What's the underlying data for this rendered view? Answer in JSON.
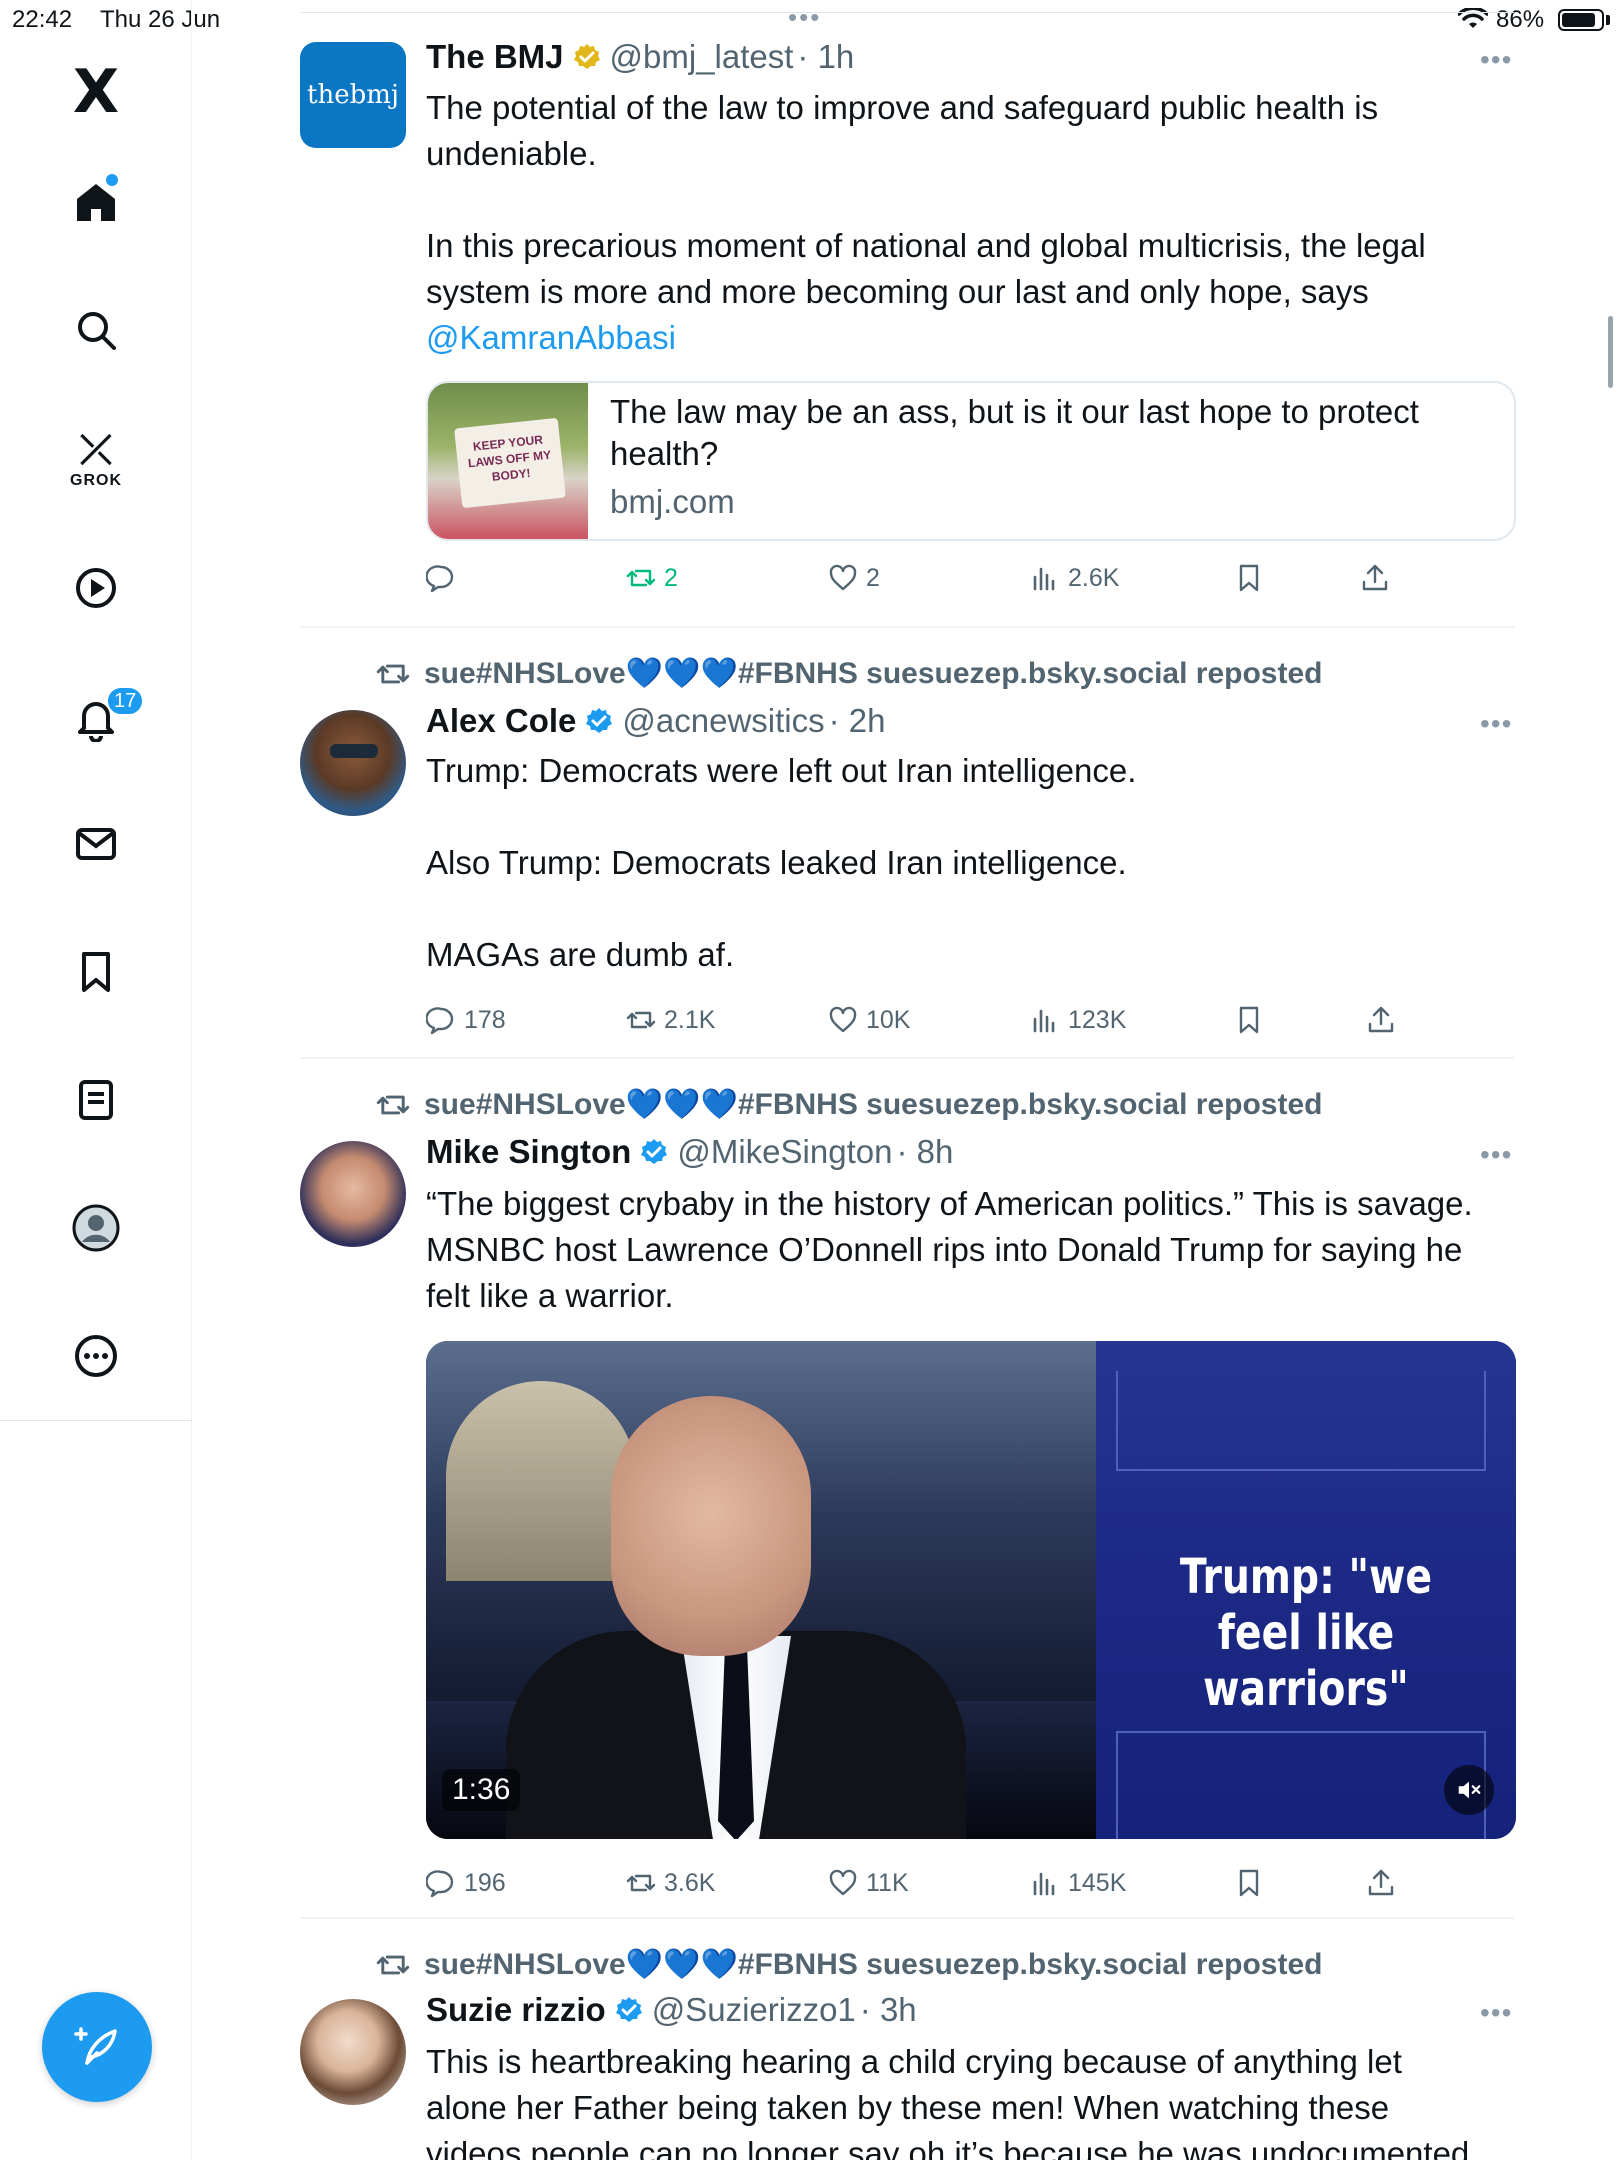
{
  "status": {
    "time": "22:42",
    "date": "Thu 26 Jun",
    "battery": "86%",
    "battery_level": 0.86
  },
  "sidebar": {
    "logo": "X",
    "grok_label": "GROK",
    "notifications_badge": "17",
    "items": [
      "home-icon",
      "search-icon",
      "grok-icon",
      "video-icon",
      "notifications-icon",
      "messages-icon",
      "bookmarks-icon",
      "lists-icon",
      "profile-icon",
      "more-icon"
    ],
    "compose_icon": "compose-icon"
  },
  "posts": [
    {
      "name": "The BMJ",
      "handle": "@bmj_latest",
      "time": "· 1h",
      "verified": "gold",
      "avatar_text": "thebmj",
      "body": [
        "The potential of the law to improve and safeguard public health is undeniable.",
        "",
        "In this precarious moment of national and global multicrisis, the legal system is more and more becoming our last and only hope, says"
      ],
      "mention": "@KamranAbbasi",
      "card": {
        "title": "The law may be an ass, but is it our last hope to protect health?",
        "domain": "bmj.com",
        "sign": "KEEP YOUR LAWS OFF MY BODY!"
      },
      "stats": {
        "replies": "",
        "reposts": "2",
        "likes": "2",
        "views": "2.6K"
      }
    },
    {
      "repost_by": "sue#NHSLove",
      "repost_hearts": "💙💙💙",
      "repost_suffix": "#FBNHS suesuezep.bsky.social reposted",
      "name": "Alex Cole",
      "handle": "@acnewsitics",
      "time": "· 2h",
      "verified": "blue",
      "body": [
        "Trump: Democrats were left out Iran intelligence.",
        "",
        "Also Trump: Democrats leaked Iran intelligence.",
        "",
        "MAGAs are dumb af."
      ],
      "stats": {
        "replies": "178",
        "reposts": "2.1K",
        "likes": "10K",
        "views": "123K"
      }
    },
    {
      "repost_by": "sue#NHSLove",
      "repost_hearts": "💙💙💙",
      "repost_suffix": "#FBNHS suesuezep.bsky.social reposted",
      "name": "Mike Sington",
      "handle": "@MikeSington",
      "time": "· 8h",
      "verified": "blue",
      "body": [
        "“The biggest crybaby in the history of American politics.” This is savage. MSNBC host Lawrence O’Donnell rips into Donald Trump for saying he felt like a warrior."
      ],
      "video": {
        "headline": "Trump: \"we feel like warriors\"",
        "duration": "1:36"
      },
      "stats": {
        "replies": "196",
        "reposts": "3.6K",
        "likes": "11K",
        "views": "145K"
      }
    },
    {
      "repost_by": "sue#NHSLove",
      "repost_hearts": "💙💙💙",
      "repost_suffix": "#FBNHS suesuezep.bsky.social reposted",
      "name": "Suzie rizzio",
      "handle": "@Suzierizzo1",
      "time": "· 3h",
      "verified": "blue",
      "body": [
        "This is heartbreaking hearing a child crying because of anything let alone her Father being taken by these men! When watching these videos people can no longer say oh it’s because he was undocumented"
      ]
    }
  ],
  "colors": {
    "accent": "#1d9bf0",
    "verified_gold": "#e2b719",
    "repost_green": "#00ba7c",
    "text": "#0f1419",
    "secondary": "#536471"
  }
}
